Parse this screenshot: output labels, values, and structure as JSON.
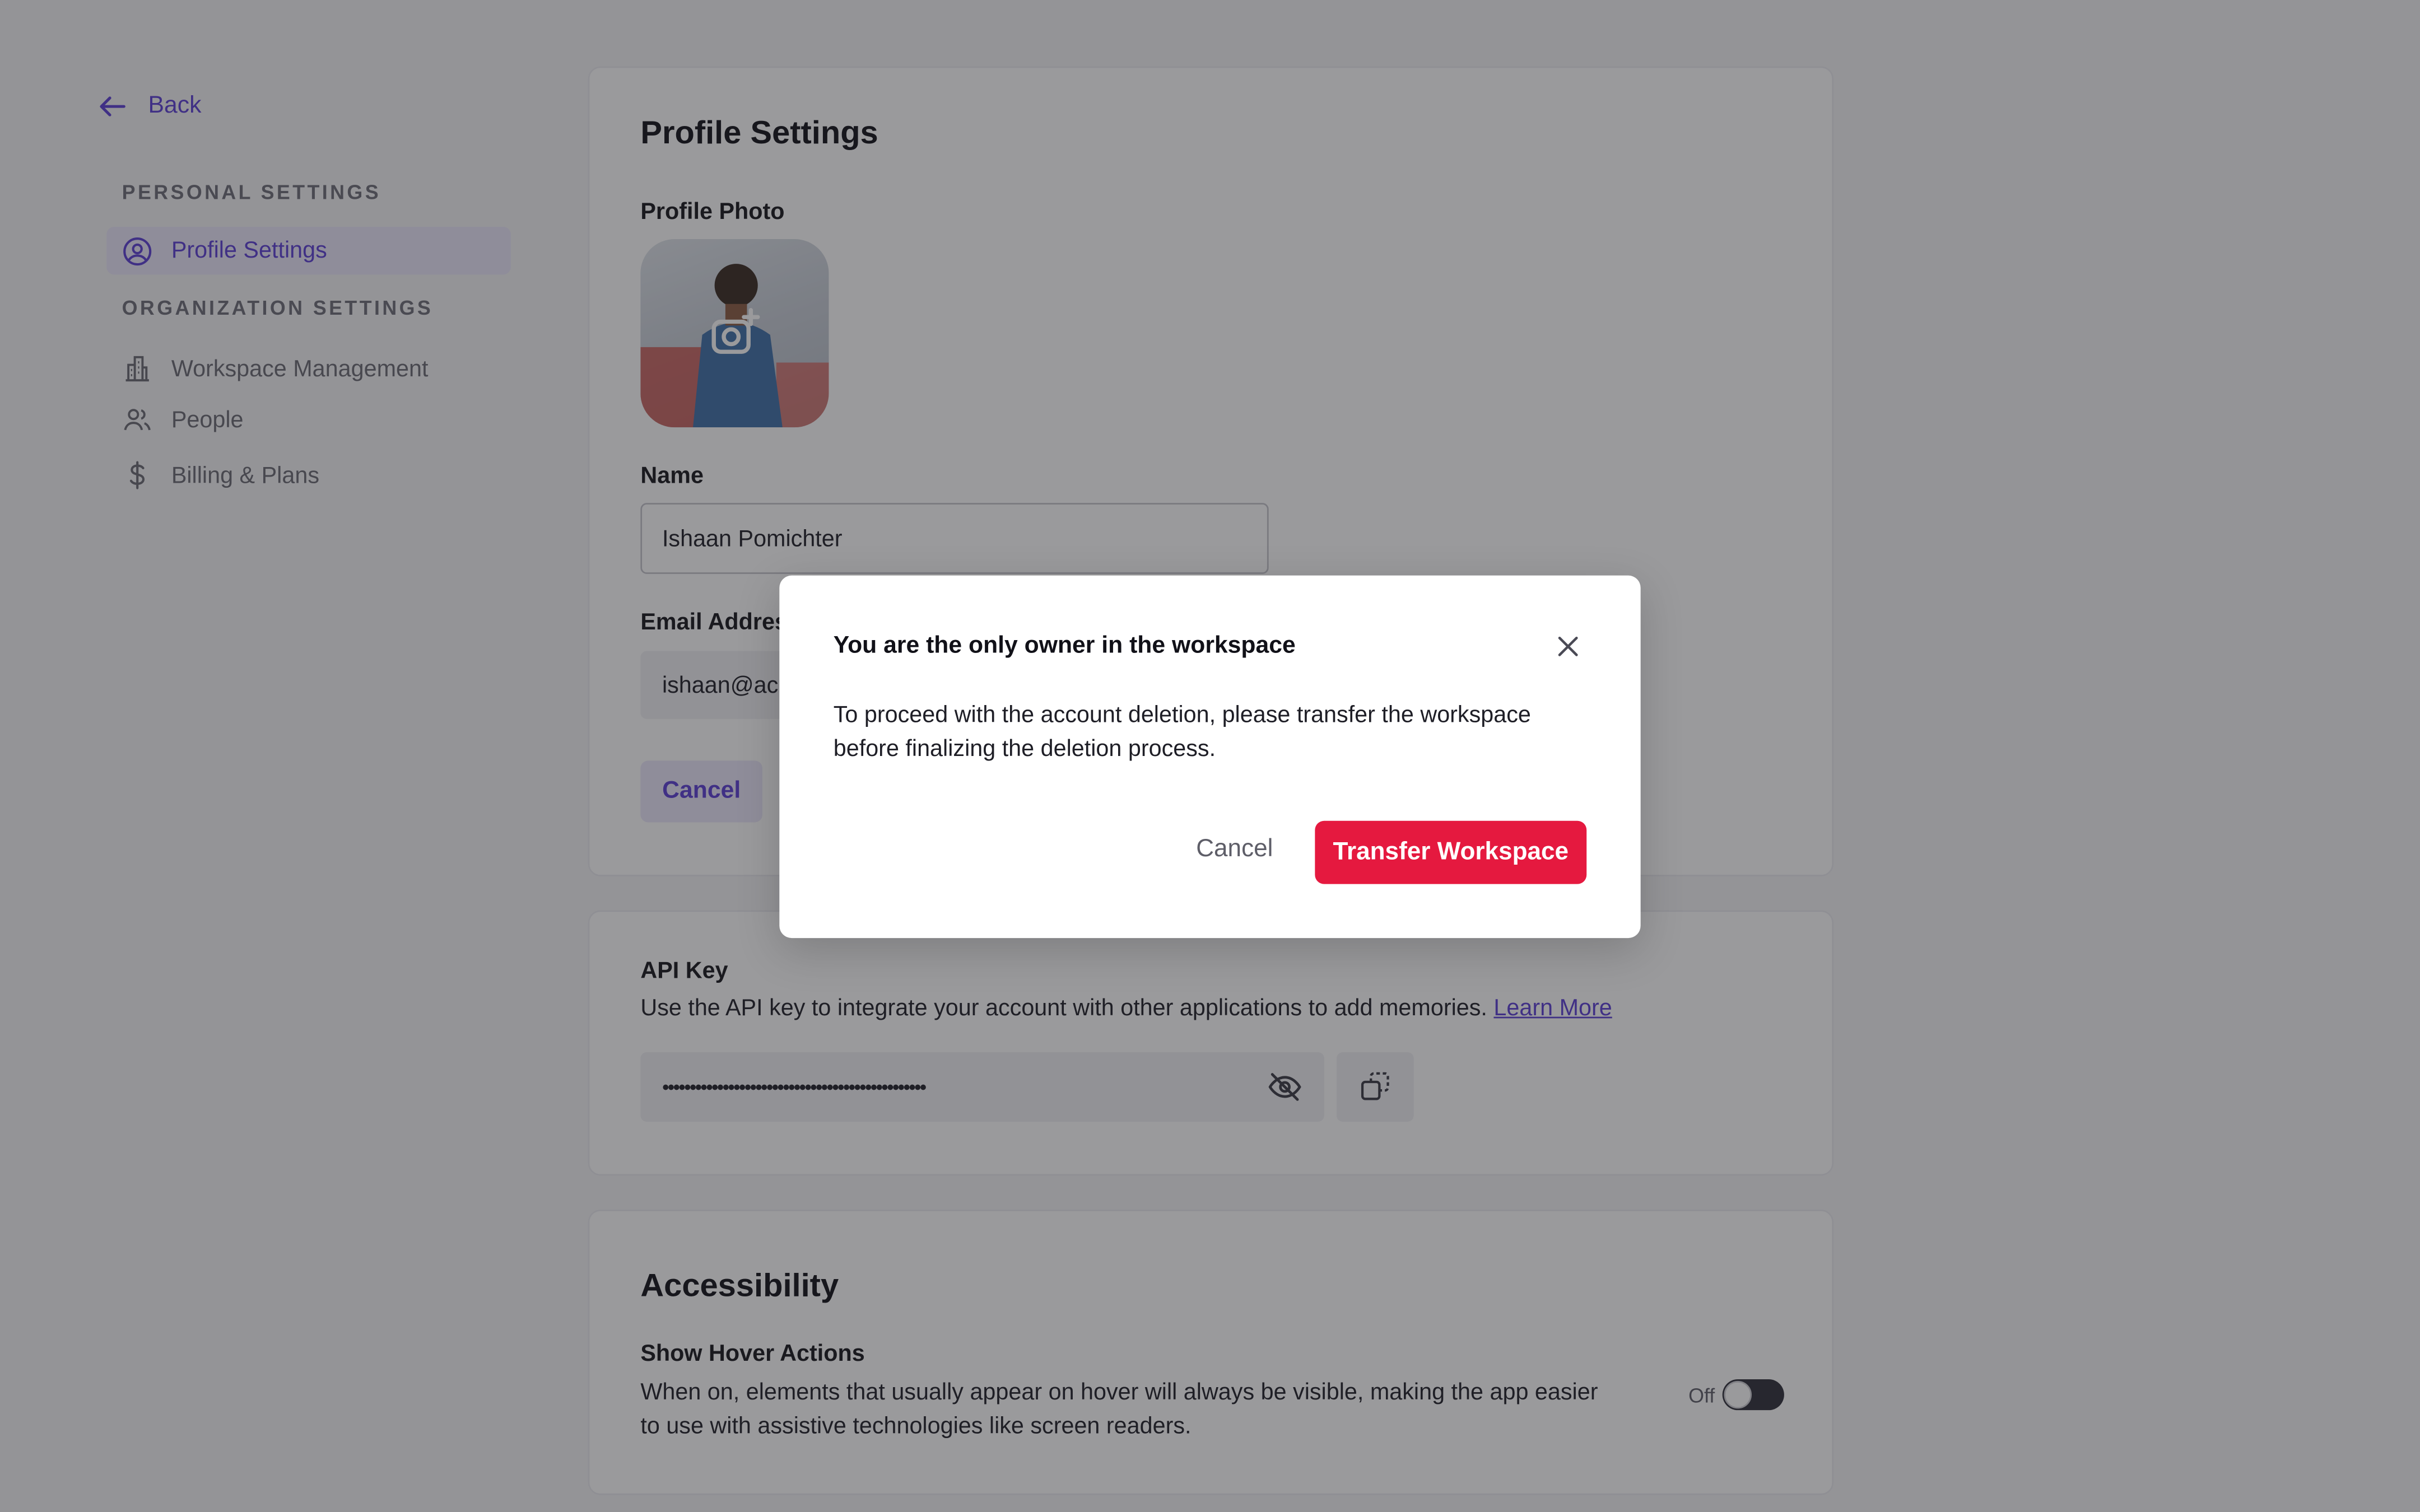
{
  "sidebar": {
    "back_label": "Back",
    "personal_settings_title": "PERSONAL SETTINGS",
    "profile_settings_label": "Profile Settings",
    "organization_settings_title": "ORGANIZATION SETTINGS",
    "items": [
      {
        "label": "Workspace Management",
        "icon": "building-icon"
      },
      {
        "label": "People",
        "icon": "people-icon"
      },
      {
        "label": "Billing & Plans",
        "icon": "dollar-icon"
      }
    ]
  },
  "profile": {
    "title": "Profile Settings",
    "photo_label": "Profile Photo",
    "name_label": "Name",
    "name_value": "Ishaan Pomichter",
    "email_label": "Email Address",
    "email_value": "ishaan@acr",
    "cancel_label": "Cancel"
  },
  "api": {
    "title": "API Key",
    "description": "Use the API key to integrate your account with other applications to add memories.",
    "learn_more": "Learn More",
    "masked_key": "••••••••••••••••••••••••••••••••••••••••••••••••"
  },
  "accessibility": {
    "title": "Accessibility",
    "hover_title": "Show Hover Actions",
    "hover_description": "When on, elements that usually appear on hover will always be visible, making the app easier to use with assistive technologies like screen readers.",
    "toggle_label": "Off",
    "toggle_on": false
  },
  "modal": {
    "title": "You are the only owner in the workspace",
    "body": "To proceed with the account deletion, please transfer the workspace before finalizing the deletion process.",
    "cancel_label": "Cancel",
    "transfer_label": "Transfer Workspace"
  },
  "colors": {
    "accent": "#5b3fd6",
    "danger": "#e5193f",
    "overlay": "rgba(30,30,36,0.45)"
  }
}
